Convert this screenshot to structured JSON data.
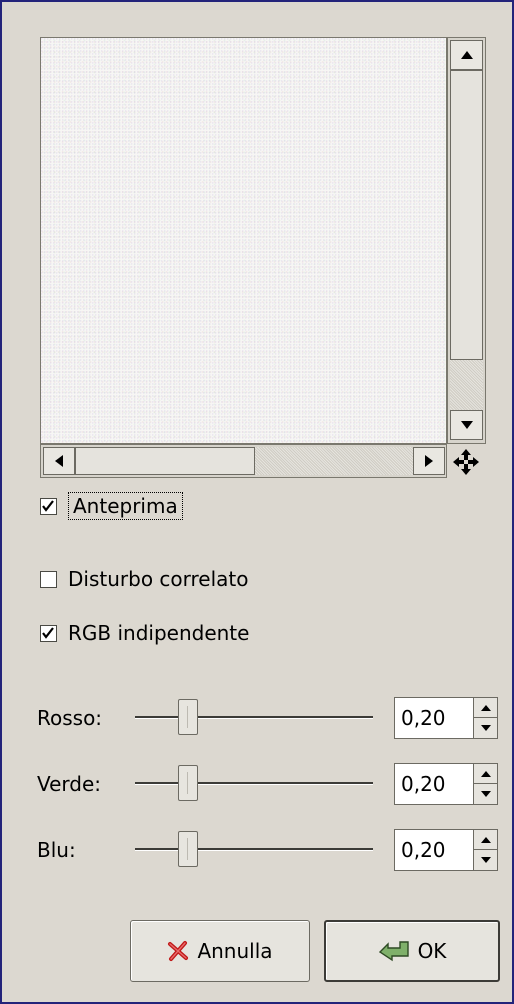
{
  "preview": {
    "checkbox_label": "Anteprima",
    "checked": true
  },
  "options": [
    {
      "label": "Disturbo correlato",
      "checked": false
    },
    {
      "label": "RGB indipendente",
      "checked": true
    }
  ],
  "sliders": [
    {
      "label": "Rosso:",
      "value": "0,20",
      "level": 0.2
    },
    {
      "label": "Verde:",
      "value": "0,20",
      "level": 0.2
    },
    {
      "label": "Blu:",
      "value": "0,20",
      "level": 0.2
    }
  ],
  "buttons": {
    "cancel_label": "Annulla",
    "ok_label": "OK"
  },
  "icons": {
    "cancel": "red-x-icon",
    "ok": "green-ok-icon",
    "navigate": "move-arrows-icon"
  }
}
